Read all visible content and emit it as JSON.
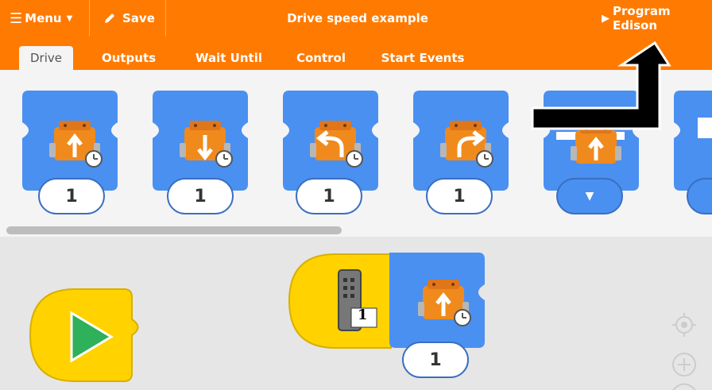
{
  "header": {
    "menu_label": "Menu",
    "save_label": "Save",
    "title": "Drive speed example",
    "program_label": "Program Edison"
  },
  "tabs": [
    {
      "label": "Drive",
      "active": true
    },
    {
      "label": "Outputs"
    },
    {
      "label": "Wait Until"
    },
    {
      "label": "Control"
    },
    {
      "label": "Start Events"
    }
  ],
  "palette": {
    "blocks": [
      {
        "icon": "drive-forward-timed-icon",
        "value": "1"
      },
      {
        "icon": "drive-backward-timed-icon",
        "value": "1"
      },
      {
        "icon": "turn-left-timed-icon",
        "value": "1"
      },
      {
        "icon": "turn-right-timed-icon",
        "value": "1"
      },
      {
        "icon": "drive-forward-dropdown-icon",
        "value": ""
      },
      {
        "icon": "drive-block-partial-icon",
        "value": ""
      }
    ]
  },
  "workspace": {
    "start_block": {
      "icon": "play-icon"
    },
    "remote_block": {
      "icon": "remote-control-icon",
      "button_number": "1"
    },
    "drive_block": {
      "icon": "drive-forward-timed-icon",
      "value": "1"
    }
  },
  "colors": {
    "header": "#ff7a00",
    "block_blue": "#4a90f0",
    "block_yellow": "#ffd200",
    "robot_orange": "#f08a1c",
    "play_green": "#2fb05a"
  }
}
